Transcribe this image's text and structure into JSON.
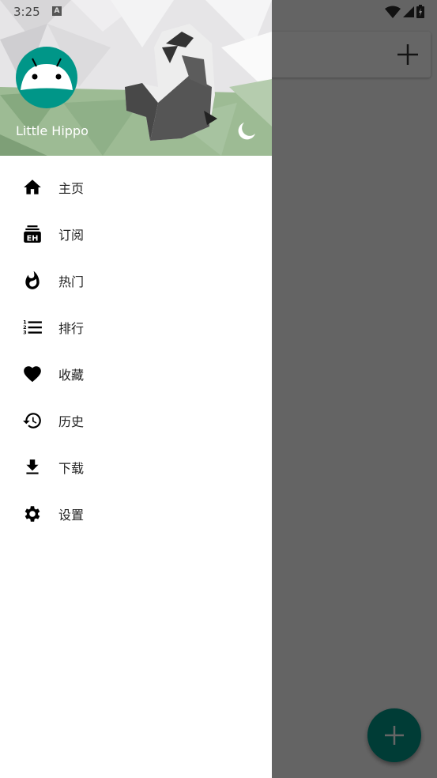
{
  "status_bar": {
    "time": "3:25",
    "keyboard_icon": "A"
  },
  "drawer": {
    "username": "Little Hippo",
    "night_mode_icon": "moon-icon",
    "items": [
      {
        "label": "主页",
        "icon": "home-icon"
      },
      {
        "label": "订阅",
        "icon": "eh-subscription-icon"
      },
      {
        "label": "热门",
        "icon": "fire-icon"
      },
      {
        "label": "排行",
        "icon": "ranked-list-icon"
      },
      {
        "label": "收藏",
        "icon": "heart-icon"
      },
      {
        "label": "历史",
        "icon": "history-icon"
      },
      {
        "label": "下载",
        "icon": "download-icon"
      },
      {
        "label": "设置",
        "icon": "gear-icon"
      }
    ]
  },
  "colors": {
    "accent": "#009688",
    "scrim": "#666666"
  }
}
